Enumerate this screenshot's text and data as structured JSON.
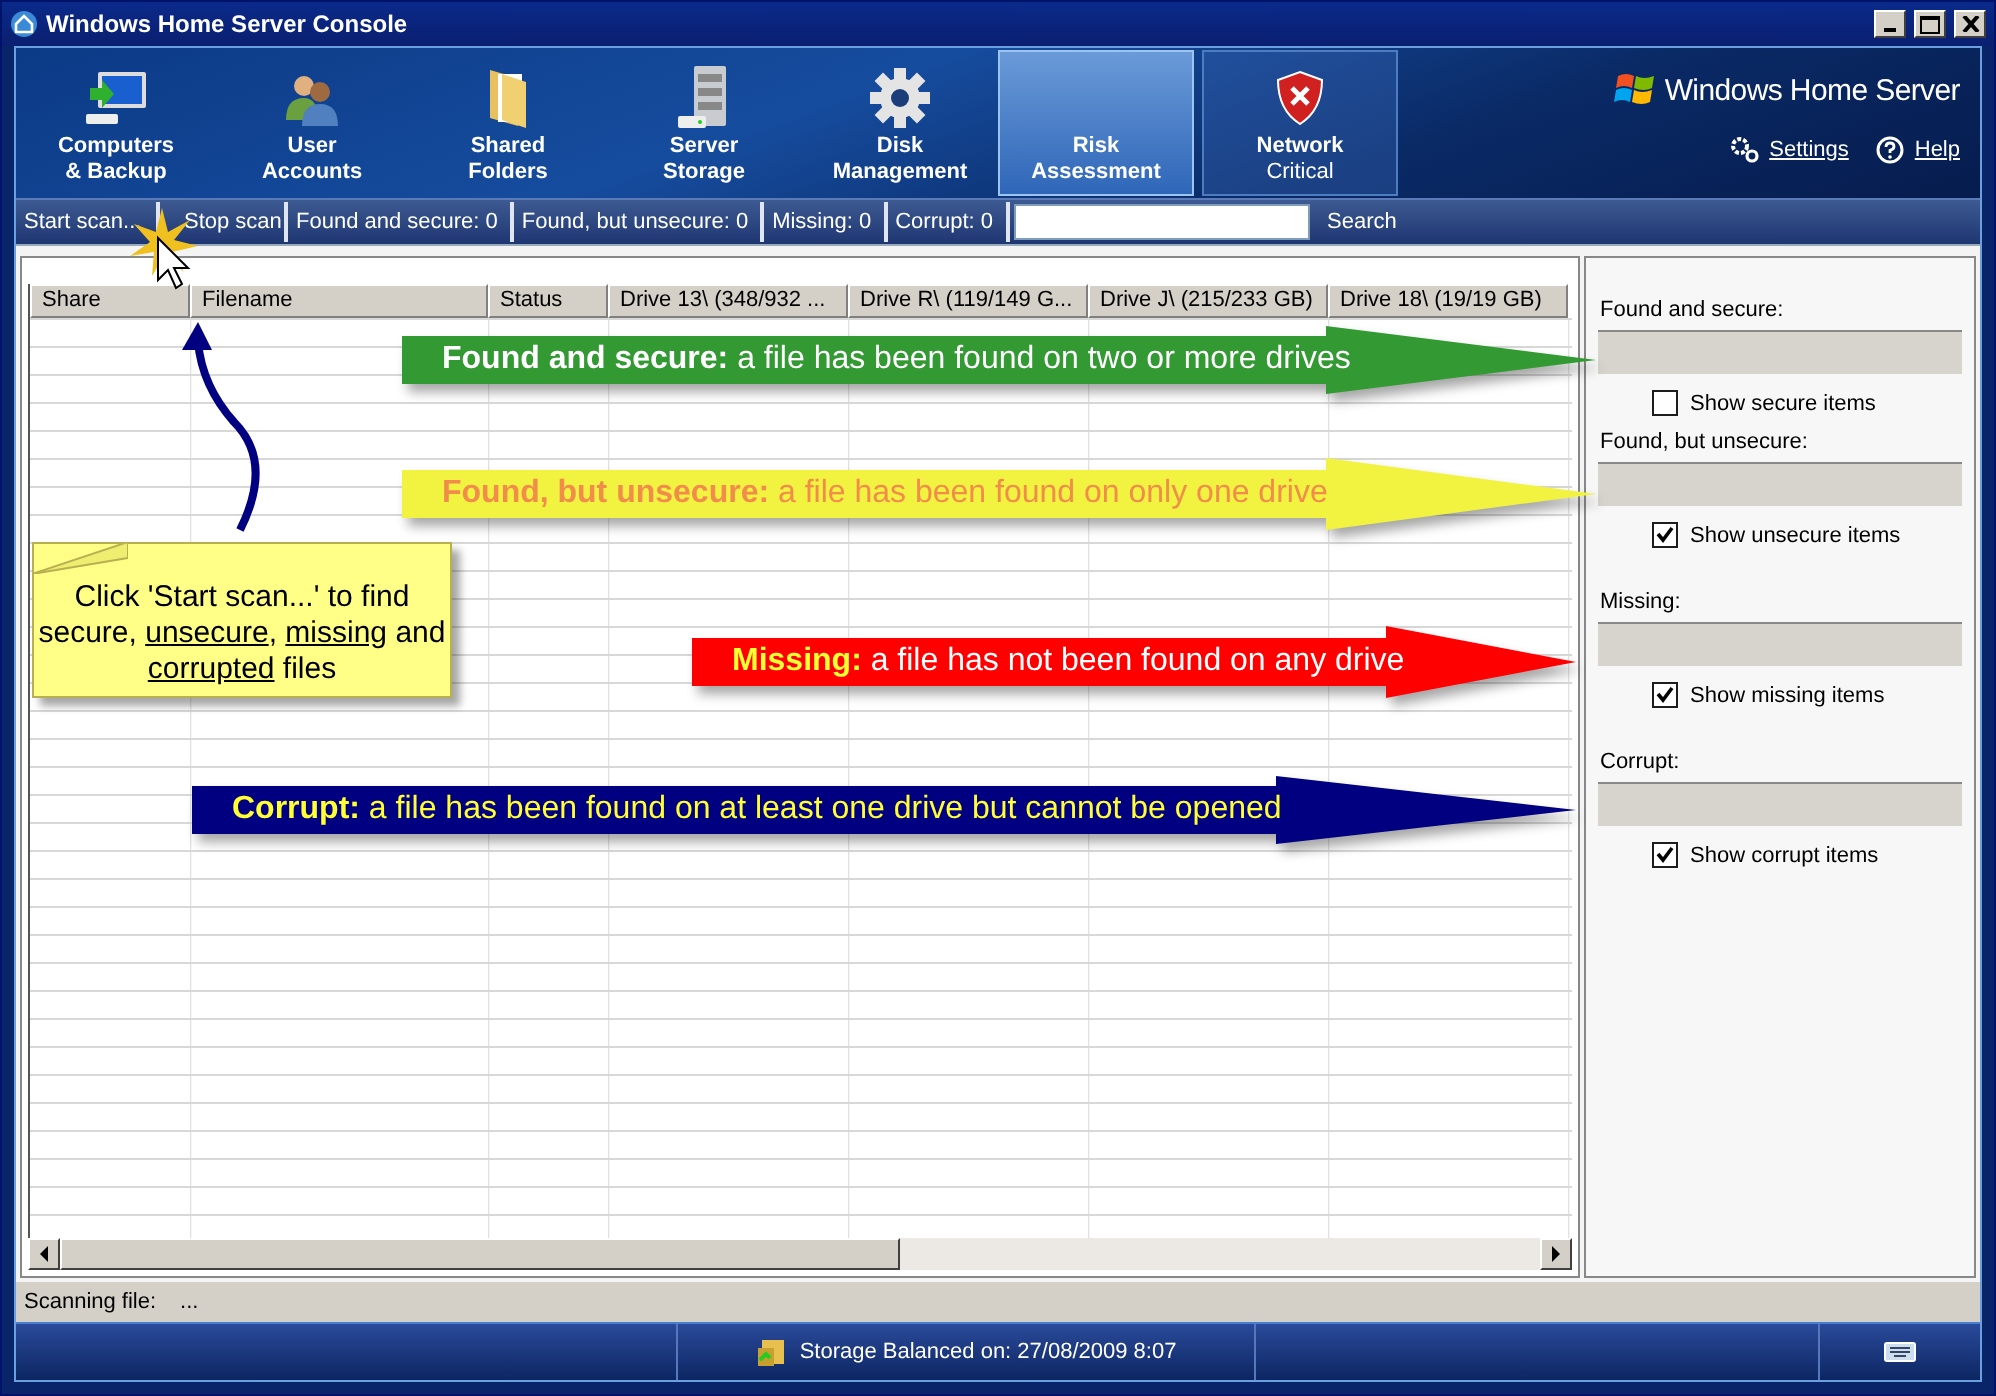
{
  "window": {
    "title": "Windows Home Server Console"
  },
  "nav_tabs": [
    {
      "label": "Computers\n& Backup",
      "selected": false
    },
    {
      "label": "User\nAccounts",
      "selected": false
    },
    {
      "label": "Shared\nFolders",
      "selected": false
    },
    {
      "label": "Server\nStorage",
      "selected": false
    },
    {
      "label": "Disk\nManagement",
      "selected": false
    },
    {
      "label": "Risk\nAssessment",
      "selected": true
    },
    {
      "label": "Network",
      "status": "Critical",
      "selected": false
    }
  ],
  "brand": "Windows Home Server",
  "header_links": [
    "Settings",
    "Help"
  ],
  "toolbar": {
    "buttons": [
      "Start scan...",
      "Stop scan"
    ],
    "counters": [
      {
        "label": "Found and secure:",
        "value": "0"
      },
      {
        "label": "Found, but unsecure:",
        "value": "0"
      },
      {
        "label": "Missing:",
        "value": "0"
      },
      {
        "label": "Corrupt:",
        "value": "0"
      }
    ],
    "search_button": "Search"
  },
  "table": {
    "columns": [
      "Share",
      "Filename",
      "Status",
      "Drive 13\\ (348/932 ...",
      "Drive R\\ (119/149 G...",
      "Drive J\\ (215/233 GB)",
      "Drive 18\\ (19/19 GB)"
    ]
  },
  "filters": [
    {
      "label": "Found and secure:",
      "checkbox": "Show secure items",
      "checked": false
    },
    {
      "label": "Found, but unsecure:",
      "checkbox": "Show unsecure items",
      "checked": true
    },
    {
      "label": "Missing:",
      "checkbox": "Show missing items",
      "checked": true
    },
    {
      "label": "Corrupt:",
      "checkbox": "Show corrupt items",
      "checked": true
    }
  ],
  "status_bar": {
    "label": "Scanning file:",
    "value": "..."
  },
  "taskbar": {
    "message": "Storage Balanced on: 27/08/2009 8:07"
  },
  "annotations": {
    "arrows": [
      {
        "text": "**Found and secure:** a file has been found on two or more drives",
        "color": "#339933",
        "kind": "secure"
      },
      {
        "text": "**Found, but unsecure:** a file has been found on only one drive",
        "color": "#f2f240",
        "kind": "unsecure"
      },
      {
        "text": "**Missing:** a file has not been found on any drive",
        "color": "#ff0000",
        "kind": "missing"
      },
      {
        "text": "**Corrupt:** a file has been found on at least one drive but cannot be opened",
        "color": "#000080",
        "kind": "corrupt"
      }
    ],
    "note": [
      {
        "text": "Click 'Start scan...' to find secure, ",
        "underlined": false
      },
      {
        "text": "unsecure",
        "underlined": true
      },
      {
        "text": ", ",
        "underlined": false
      },
      {
        "text": "missing",
        "underlined": true
      },
      {
        "text": " and ",
        "underlined": false
      },
      {
        "text": "corrupted",
        "underlined": true
      },
      {
        "text": " files",
        "underlined": false
      }
    ]
  }
}
